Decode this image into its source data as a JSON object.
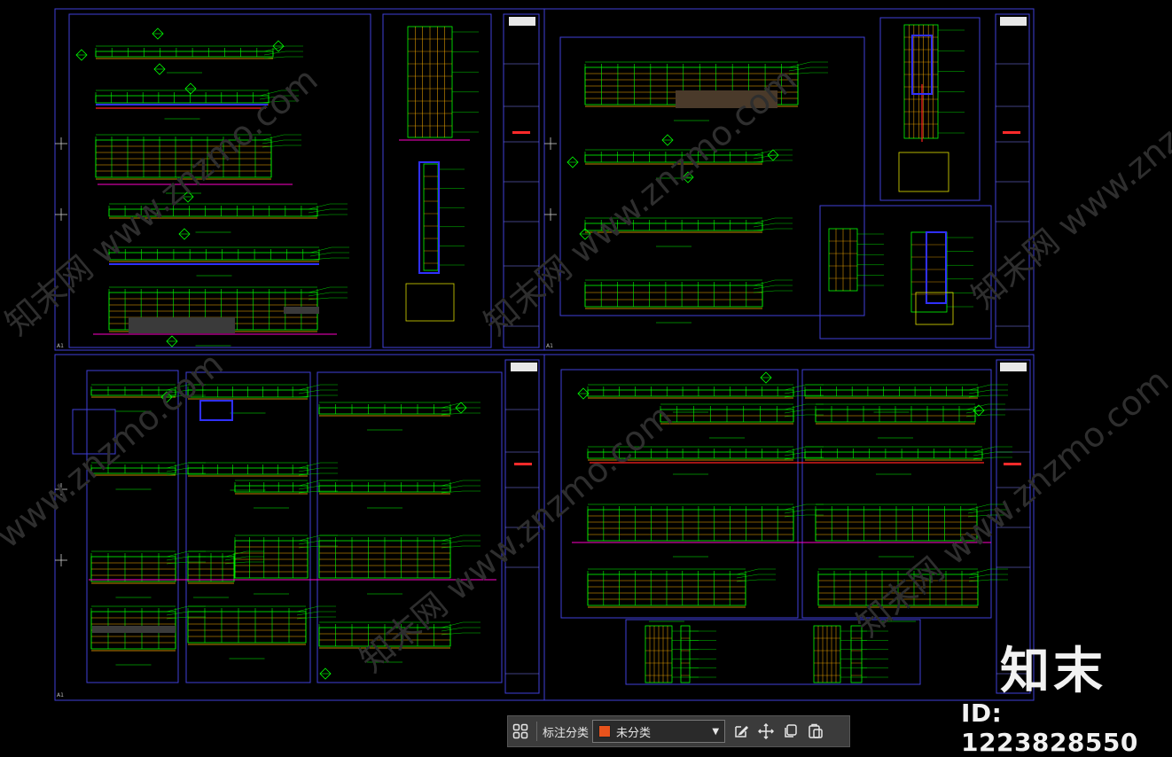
{
  "toolbar": {
    "label": "标注分类",
    "category_value": "未分类",
    "category_color": "#e8531c",
    "icons": [
      "grid-icon",
      "edit-icon",
      "move-icon",
      "copy-icon",
      "paste-icon"
    ]
  },
  "watermark": {
    "brand": "知末",
    "id_text": "ID: 1223828550"
  },
  "colors": {
    "background": "#000000",
    "sheet_border": "#3f3fd8",
    "linework": "#00ff00",
    "accent": "#ffb000",
    "red": "#ff2020",
    "magenta": "#ff00c8",
    "blue": "#2a2aff"
  },
  "sheet_label": "A1"
}
